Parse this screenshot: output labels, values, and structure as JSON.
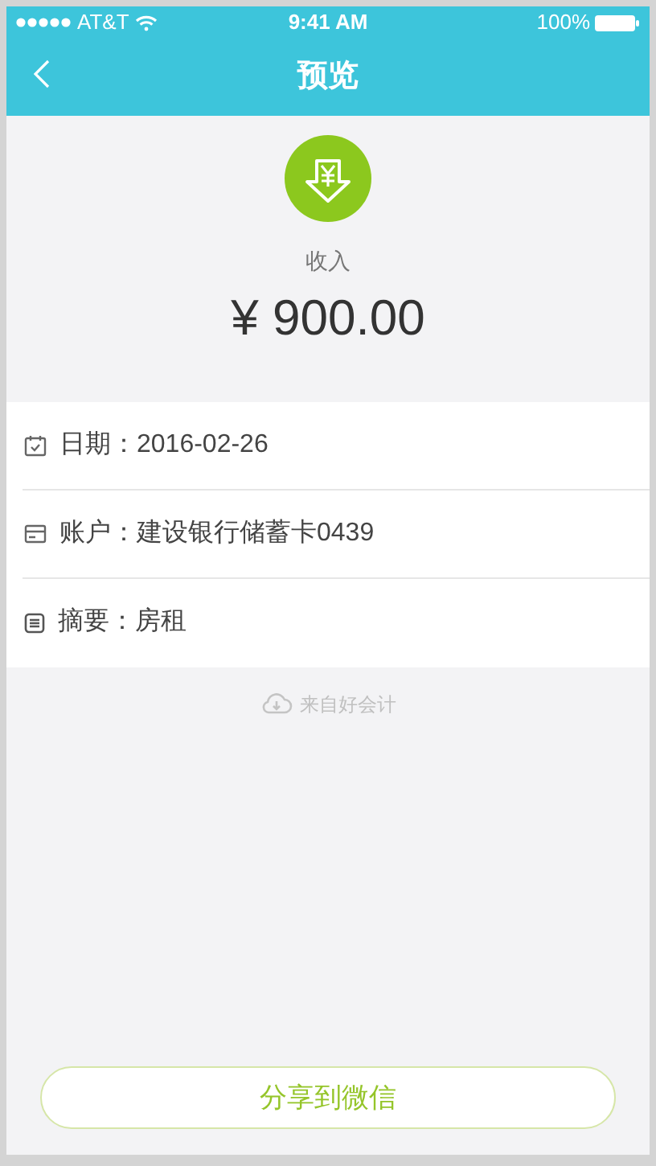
{
  "status_bar": {
    "carrier": "AT&T",
    "time": "9:41 AM",
    "battery": "100%"
  },
  "nav": {
    "title": "预览"
  },
  "summary": {
    "type": "收入",
    "amount": "¥ 900.00"
  },
  "details": [
    {
      "kind": "date",
      "label": "日期：",
      "value": "2016-02-26"
    },
    {
      "kind": "account",
      "label": "账户：",
      "value": "建设银行储蓄卡0439"
    },
    {
      "kind": "note",
      "label": "摘要：",
      "value": "房租"
    }
  ],
  "source": "来自好会计",
  "share_button": "分享到微信"
}
